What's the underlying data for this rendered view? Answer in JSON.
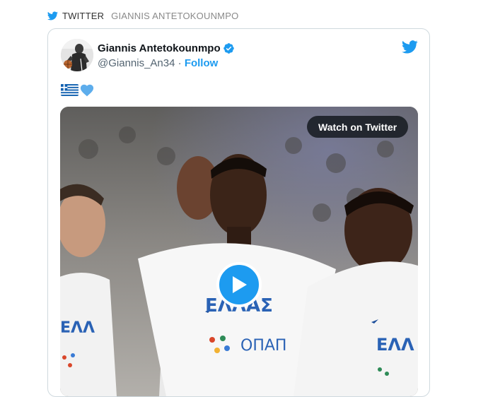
{
  "source": {
    "label": "TWITTER",
    "author": "GIANNIS ANTETOKOUNMPO"
  },
  "tweet": {
    "author_name": "Giannis Antetokounmpo",
    "handle": "@Giannis_An34",
    "separator": "·",
    "follow_label": "Follow",
    "verified": true,
    "text_emoji": [
      "greek-flag",
      "blue-heart"
    ],
    "watch_label": "Watch on Twitter",
    "jersey_texts": [
      "ΕΛΛΑΣ",
      "ΕΛΛ",
      "ΕΛΛ",
      "ΟΠΑΠ"
    ]
  },
  "colors": {
    "twitter_blue": "#1d9bf0",
    "text_primary": "#0f1419",
    "text_secondary": "#536471",
    "border": "#cfd9de"
  }
}
